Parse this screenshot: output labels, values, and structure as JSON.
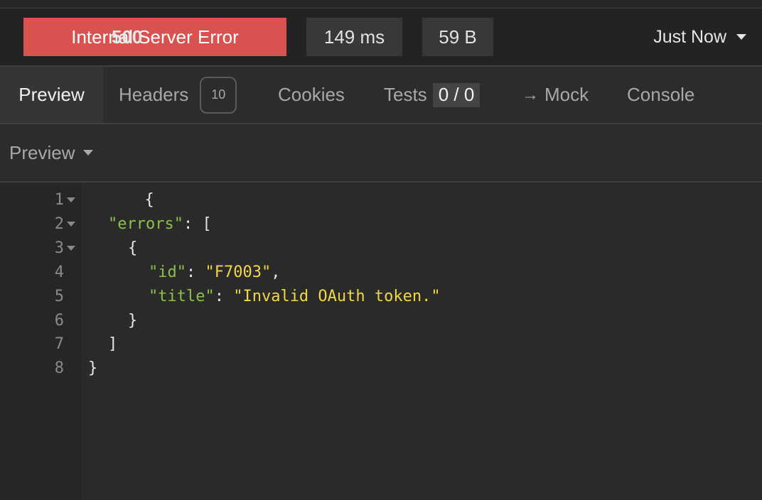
{
  "response_status": {
    "code": "500",
    "text": "Internal Server Error",
    "time": "149 ms",
    "size": "59 B",
    "history_label": "Just Now",
    "colors": {
      "error_badge": "#d9524f",
      "pill_bg": "#383838"
    }
  },
  "tabs": {
    "preview": "Preview",
    "headers": "Headers",
    "headers_count": "10",
    "cookies": "Cookies",
    "tests": "Tests",
    "tests_result": "0 / 0",
    "mock_arrow": "→",
    "mock": "Mock",
    "console": "Console",
    "active": "Preview"
  },
  "preview_mode": {
    "label": "Preview",
    "icon": "chevron-down-icon"
  },
  "editor": {
    "language": "json",
    "colors": {
      "key": "#8dc149",
      "string": "#f0d748"
    },
    "lines": [
      {
        "n": "1",
        "foldable": true
      },
      {
        "n": "2",
        "foldable": true
      },
      {
        "n": "3",
        "foldable": true
      },
      {
        "n": "4",
        "foldable": false
      },
      {
        "n": "5",
        "foldable": false
      },
      {
        "n": "6",
        "foldable": false
      },
      {
        "n": "7",
        "foldable": false
      },
      {
        "n": "8",
        "foldable": false
      }
    ],
    "tokens": {
      "open_brace": "{",
      "errors_key": "\"errors\"",
      "errors_sep": ": [",
      "inner_open": "{",
      "id_key": "\"id\"",
      "id_sep": ": ",
      "id_value": "\"F7003\"",
      "id_comma": ",",
      "title_key": "\"title\"",
      "title_sep": ": ",
      "title_value": "\"Invalid OAuth token.\"",
      "inner_close": "}",
      "array_close": "]",
      "close_brace": "}"
    }
  }
}
